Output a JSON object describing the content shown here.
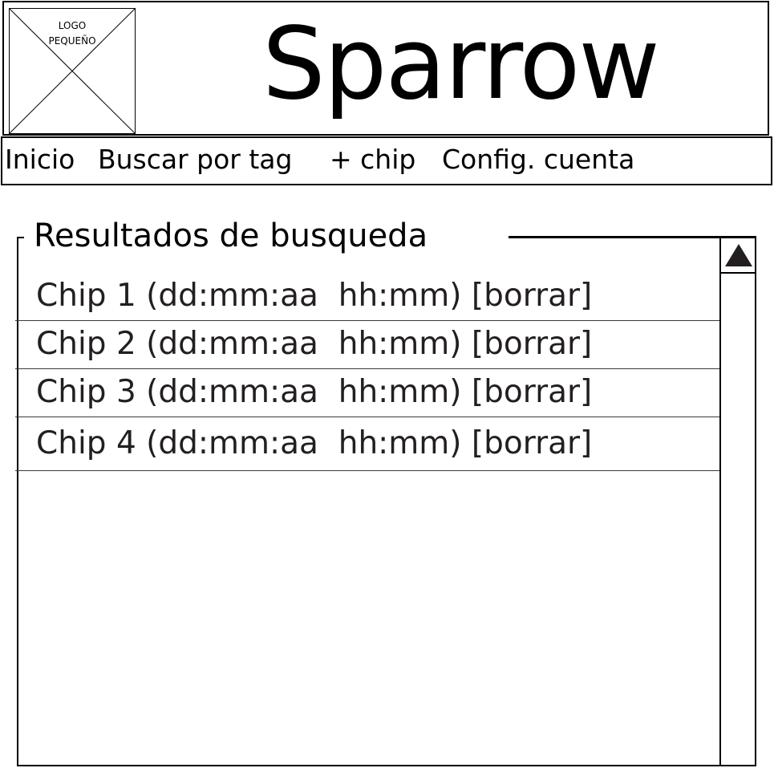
{
  "header": {
    "logo_text": "LOGO\nPEQUEÑO",
    "app_title": "Sparrow"
  },
  "nav": {
    "items": [
      {
        "label": "Inicio"
      },
      {
        "label": "Buscar por tag"
      },
      {
        "label": "+ chip"
      },
      {
        "label": "Config. cuenta"
      }
    ]
  },
  "results": {
    "title": "Resultados de busqueda",
    "rows": [
      {
        "label": "Chip 1 (dd:mm:aa  hh:mm) [borrar]"
      },
      {
        "label": "Chip 2 (dd:mm:aa  hh:mm) [borrar]"
      },
      {
        "label": "Chip 3 (dd:mm:aa  hh:mm) [borrar]"
      },
      {
        "label": "Chip 4 (dd:mm:aa  hh:mm) [borrar]"
      }
    ]
  },
  "icons": {
    "scroll_up": "triangle-up-icon",
    "logo": "image-placeholder-icon"
  }
}
